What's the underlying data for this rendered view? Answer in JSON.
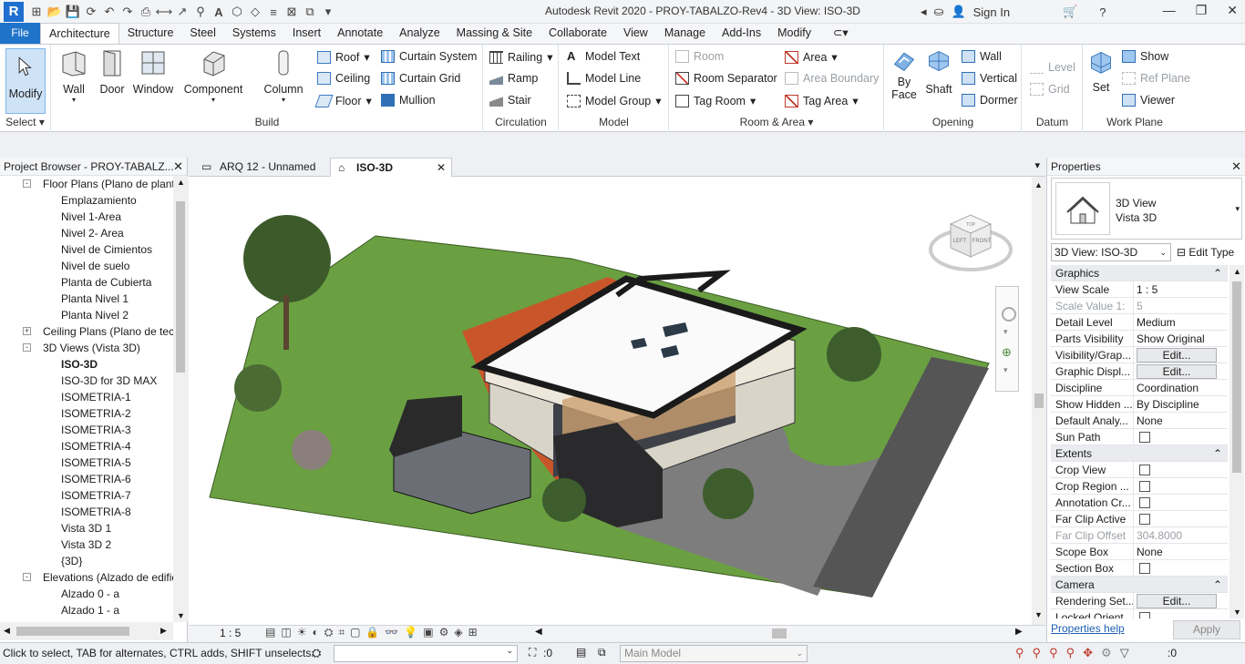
{
  "titlebar": {
    "logo": "R",
    "title": "Autodesk Revit 2020 - PROY-TABALZO-Rev4 - 3D View: ISO-3D",
    "signin": "Sign In"
  },
  "tabs": {
    "file": "File",
    "items": [
      "Architecture",
      "Structure",
      "Steel",
      "Systems",
      "Insert",
      "Annotate",
      "Analyze",
      "Massing & Site",
      "Collaborate",
      "View",
      "Manage",
      "Add-Ins",
      "Modify"
    ]
  },
  "ribbon": {
    "select": {
      "modify": "Modify",
      "label": "Select"
    },
    "build": {
      "label": "Build",
      "wall": "Wall",
      "door": "Door",
      "window": "Window",
      "component": "Component",
      "column": "Column",
      "roof": "Roof",
      "ceiling": "Ceiling",
      "floor": "Floor",
      "curtain_system": "Curtain System",
      "curtain_grid": "Curtain Grid",
      "mullion": "Mullion"
    },
    "circulation": {
      "label": "Circulation",
      "railing": "Railing",
      "ramp": "Ramp",
      "stair": "Stair"
    },
    "model": {
      "label": "Model",
      "model_text": "Model Text",
      "model_line": "Model Line",
      "model_group": "Model Group"
    },
    "room_area": {
      "label": "Room & Area",
      "room": "Room",
      "room_separator": "Room Separator",
      "tag_room": "Tag Room",
      "area": "Area",
      "area_boundary": "Area Boundary",
      "tag_area": "Tag Area"
    },
    "opening": {
      "label": "Opening",
      "by_face": "By Face",
      "shaft": "Shaft",
      "wall": "Wall",
      "vertical": "Vertical",
      "dormer": "Dormer"
    },
    "datum": {
      "label": "Datum",
      "level": "Level",
      "grid": "Grid"
    },
    "workplane": {
      "label": "Work Plane",
      "set": "Set",
      "show": "Show",
      "ref_plane": "Ref Plane",
      "viewer": "Viewer"
    }
  },
  "browser": {
    "title": "Project Browser - PROY-TABALZ...",
    "rows": [
      {
        "text": "Floor Plans (Plano de plant",
        "level": 0,
        "expand": "-"
      },
      {
        "text": "Emplazamiento",
        "level": 1
      },
      {
        "text": "Nivel 1-Area",
        "level": 1
      },
      {
        "text": "Nivel 2- Area",
        "level": 1
      },
      {
        "text": "Nivel de Cimientos",
        "level": 1
      },
      {
        "text": "Nivel de suelo",
        "level": 1
      },
      {
        "text": "Planta de Cubierta",
        "level": 1
      },
      {
        "text": "Planta Nivel 1",
        "level": 1
      },
      {
        "text": "Planta Nivel 2",
        "level": 1
      },
      {
        "text": "Ceiling Plans (Plano de tech",
        "level": 0,
        "expand": "+"
      },
      {
        "text": "3D Views (Vista 3D)",
        "level": 0,
        "expand": "-"
      },
      {
        "text": "ISO-3D",
        "level": 1,
        "selected": true
      },
      {
        "text": "ISO-3D  for 3D MAX",
        "level": 1
      },
      {
        "text": "ISOMETRIA-1",
        "level": 1
      },
      {
        "text": "ISOMETRIA-2",
        "level": 1
      },
      {
        "text": "ISOMETRIA-3",
        "level": 1
      },
      {
        "text": "ISOMETRIA-4",
        "level": 1
      },
      {
        "text": "ISOMETRIA-5",
        "level": 1
      },
      {
        "text": "ISOMETRIA-6",
        "level": 1
      },
      {
        "text": "ISOMETRIA-7",
        "level": 1
      },
      {
        "text": "ISOMETRIA-8",
        "level": 1
      },
      {
        "text": "Vista 3D 1",
        "level": 1
      },
      {
        "text": "Vista 3D 2",
        "level": 1
      },
      {
        "text": "{3D}",
        "level": 1
      },
      {
        "text": "Elevations (Alzado de edific",
        "level": 0,
        "expand": "-"
      },
      {
        "text": "Alzado 0 - a",
        "level": 1
      },
      {
        "text": "Alzado 1 - a",
        "level": 1
      },
      {
        "text": "Alzado 2",
        "level": 1
      }
    ]
  },
  "viewtabs": {
    "tab1": "ARQ 12 - Unnamed",
    "tab2": "ISO-3D"
  },
  "viewcube": {
    "top": "TOP",
    "left": "LEFT",
    "front": "FRONT"
  },
  "viewbar": {
    "scale": "1 : 5"
  },
  "properties": {
    "title": "Properties",
    "type_line1": "3D View",
    "type_line2": "Vista 3D",
    "view_selector": "3D View: ISO-3D",
    "edit_type": "Edit Type",
    "rows": [
      {
        "group": "Graphics"
      },
      {
        "k": "View Scale",
        "v": "1 : 5"
      },
      {
        "k": "Scale Value    1:",
        "v": "5",
        "grey": true
      },
      {
        "k": "Detail Level",
        "v": "Medium"
      },
      {
        "k": "Parts Visibility",
        "v": "Show Original"
      },
      {
        "k": "Visibility/Grap...",
        "btn": "Edit..."
      },
      {
        "k": "Graphic Displ...",
        "btn": "Edit..."
      },
      {
        "k": "Discipline",
        "v": "Coordination"
      },
      {
        "k": "Show Hidden ...",
        "v": "By Discipline"
      },
      {
        "k": "Default Analy...",
        "v": "None"
      },
      {
        "k": "Sun Path",
        "check": true
      },
      {
        "group": "Extents"
      },
      {
        "k": "Crop View",
        "check": true
      },
      {
        "k": "Crop Region ...",
        "check": true
      },
      {
        "k": "Annotation Cr...",
        "check": true
      },
      {
        "k": "Far Clip Active",
        "check": true
      },
      {
        "k": "Far Clip Offset",
        "v": "304.8000",
        "grey": true
      },
      {
        "k": "Scope Box",
        "v": "None"
      },
      {
        "k": "Section Box",
        "check": true
      },
      {
        "group": "Camera"
      },
      {
        "k": "Rendering Set...",
        "btn": "Edit..."
      },
      {
        "k": "Locked Orient...",
        "check": true
      }
    ],
    "help": "Properties help",
    "apply": "Apply"
  },
  "status": {
    "text": "Click to select, TAB for alternates, CTRL adds, SHIFT unselects.",
    "workset_count": ":0",
    "model": "Main Model",
    "filter_count": ":0"
  }
}
